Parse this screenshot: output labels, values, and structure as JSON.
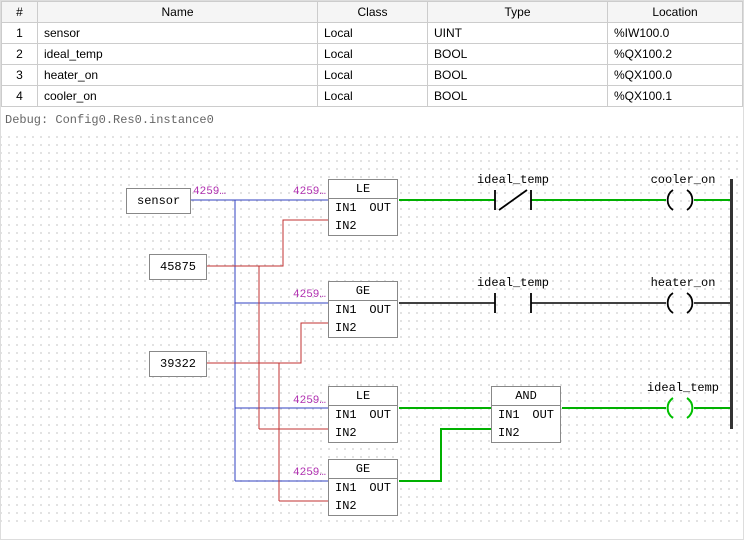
{
  "table": {
    "headers": {
      "num": "#",
      "name": "Name",
      "class": "Class",
      "type": "Type",
      "location": "Location"
    },
    "rows": [
      {
        "num": "1",
        "name": "sensor",
        "class": "Local",
        "type": "UINT",
        "location": "%IW100.0"
      },
      {
        "num": "2",
        "name": "ideal_temp",
        "class": "Local",
        "type": "BOOL",
        "location": "%QX100.2"
      },
      {
        "num": "3",
        "name": "heater_on",
        "class": "Local",
        "type": "BOOL",
        "location": "%QX100.0"
      },
      {
        "num": "4",
        "name": "cooler_on",
        "class": "Local",
        "type": "BOOL",
        "location": "%QX100.1"
      }
    ]
  },
  "debug_label": "Debug: Config0.Res0.instance0",
  "ladder": {
    "sensor_var": "sensor",
    "const_hi": "45875",
    "const_lo": "39322",
    "fb": {
      "le": {
        "title": "LE",
        "in1": "IN1",
        "in2": "IN2",
        "out": "OUT"
      },
      "ge": {
        "title": "GE",
        "in1": "IN1",
        "in2": "IN2",
        "out": "OUT"
      },
      "and": {
        "title": "AND",
        "in1": "IN1",
        "in2": "IN2",
        "out": "OUT"
      }
    },
    "contacts": {
      "ideal_temp": "ideal_temp",
      "heater_on": "heater_on",
      "cooler_on": "cooler_on"
    },
    "wire_val": "4259…",
    "colors": {
      "sensor_bus": "#3040c0",
      "const_bus": "#c03030",
      "debug_val": "#b030b0",
      "bool_true": "#00b000",
      "bool_false": "#000000",
      "coil_true": "#00c000"
    }
  }
}
